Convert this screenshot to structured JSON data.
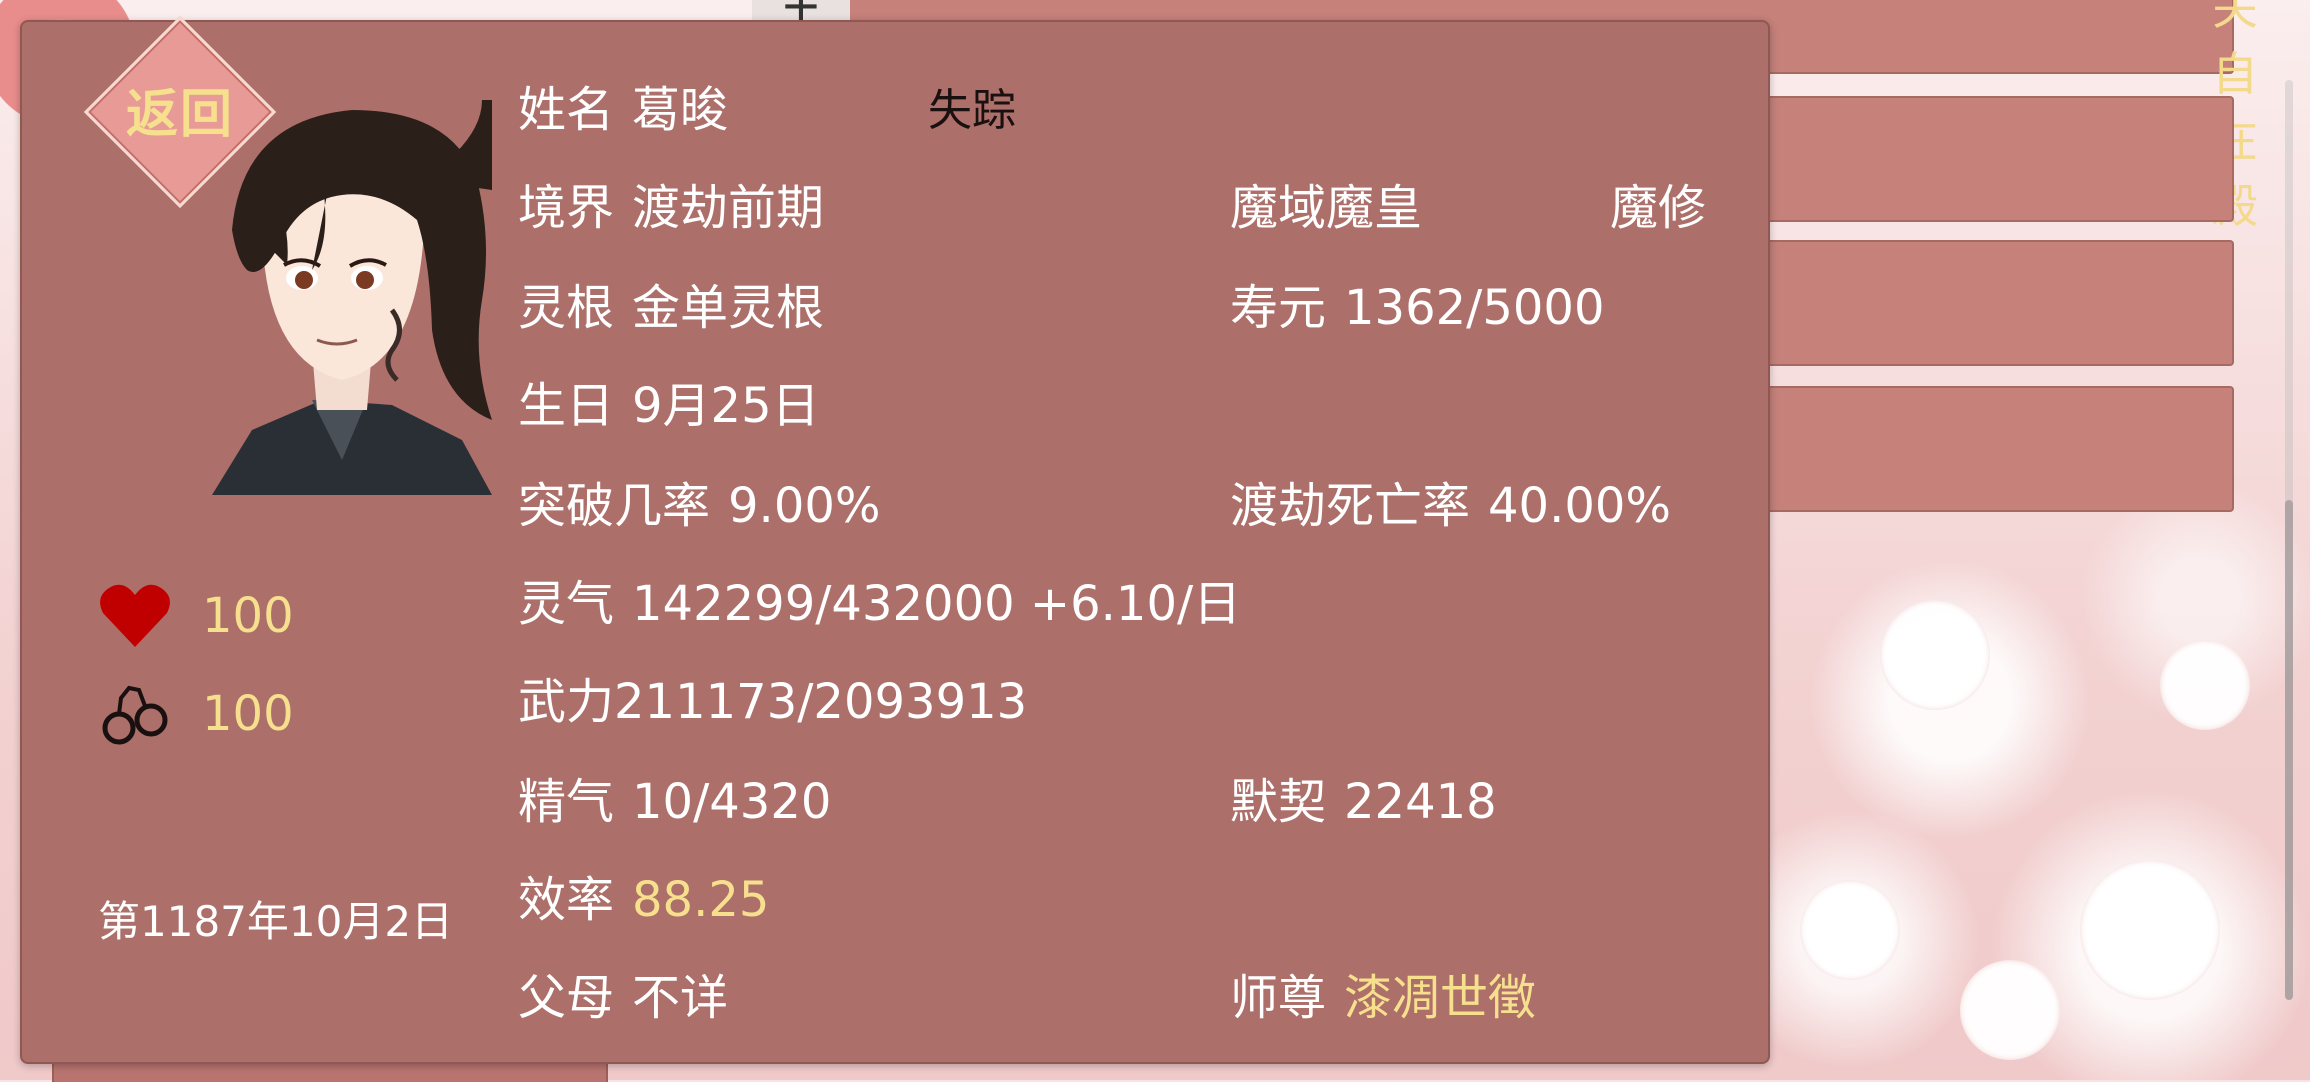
{
  "background": {
    "top_panel_title": "关自在殿",
    "plus_label": "+"
  },
  "modal": {
    "back_label": "返回",
    "health": {
      "value": "100"
    },
    "bond": {
      "value": "100"
    },
    "date": "第1187年10月2日",
    "status": "失踪",
    "fields": {
      "name": {
        "label": "姓名",
        "value": "葛晙"
      },
      "realm": {
        "label": "境界",
        "value": "渡劫前期"
      },
      "title": "魔域魔皇",
      "sect_type": "魔修",
      "root": {
        "label": "灵根",
        "value": "金单灵根"
      },
      "lifespan": {
        "label": "寿元",
        "value": "1362/5000"
      },
      "birthday": {
        "label": "生日",
        "value": "9月25日"
      },
      "breakthrough": {
        "label": "突破几率",
        "value": "9.00%"
      },
      "tribulation_death": {
        "label": "渡劫死亡率",
        "value": "40.00%"
      },
      "qi": {
        "label": "灵气",
        "value": "142299/432000 +6.10/日"
      },
      "force": {
        "label": "武力",
        "value": "211173/2093913"
      },
      "essence": {
        "label": "精气",
        "value": "10/4320"
      },
      "tacit": {
        "label": "默契",
        "value": "22418"
      },
      "efficiency": {
        "label": "效率",
        "value": "88.25"
      },
      "parents": {
        "label": "父母",
        "value": "不详"
      },
      "master": {
        "label": "师尊",
        "value": "漆凋世徵"
      }
    }
  },
  "colors": {
    "modal_bg": "#ad6f69",
    "gold_text": "#f6e08e",
    "heart": "#c00000"
  }
}
